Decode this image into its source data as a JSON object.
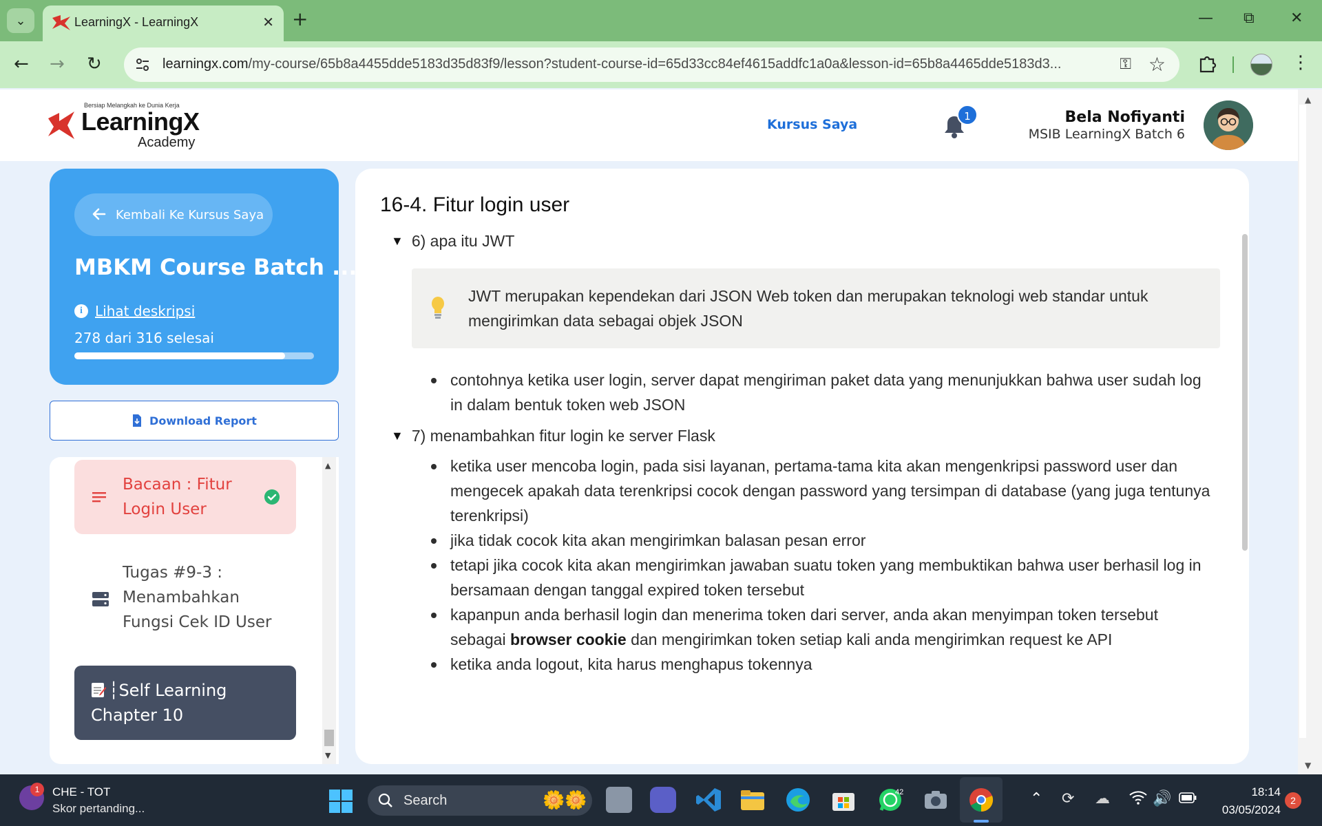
{
  "browser": {
    "tab_title": "LearningX - LearningX",
    "url_main": "learningx.com",
    "url_rest": "/my-course/65b8a4455dde5183d35d83f9/lesson?student-course-id=65d33cc84ef4615addfc1a0a&lesson-id=65b8a4465dde5183d3..."
  },
  "header": {
    "logo_tagline": "Bersiap Melangkah ke Dunia Kerja",
    "logo_word": "LearningX",
    "logo_sub": "Academy",
    "nav_kursus": "Kursus Saya",
    "notification_count": "1",
    "user_name": "Bela Nofiyanti",
    "user_batch": "MSIB LearningX Batch 6"
  },
  "sidebar": {
    "back_label": "Kembali Ke Kursus Saya",
    "course_title": "MBKM Course Batch ...",
    "description_link": "Lihat deskripsi",
    "progress_text": "278 dari 316 selesai",
    "progress_done": 278,
    "progress_total": 316,
    "download_label": "Download Report",
    "lessons": [
      {
        "label": "Bacaan : Fitur Login User",
        "active": true,
        "completed": true
      },
      {
        "label": "Tugas #9-3 : Menambahkan Fungsi Cek ID User",
        "active": false
      }
    ],
    "chapter_label": "┆Self Learning Chapter 10"
  },
  "content": {
    "title": "16-4.  Fitur login user",
    "section6": {
      "heading": "6)  apa itu JWT",
      "callout": "JWT merupakan kependekan dari JSON Web token dan merupakan teknologi web standar untuk mengirimkan data sebagai objek JSON",
      "bullets": [
        "contohnya ketika user login, server dapat mengiriman paket data yang menunjukkan bahwa user sudah log in dalam bentuk token web JSON"
      ]
    },
    "section7": {
      "heading": "7)  menambahkan fitur login ke server Flask",
      "bullets": [
        "ketika user mencoba login, pada sisi layanan, pertama-tama kita akan mengenkripsi password user dan mengecek apakah data terenkripsi cocok dengan password yang tersimpan di database (yang juga tentunya terenkripsi)",
        "jika tidak cocok kita akan mengirimkan balasan pesan error",
        "tetapi jika cocok kita akan mengirimkan jawaban suatu token yang membuktikan bahwa user berhasil log in bersamaan dengan tanggal expired token tersebut"
      ],
      "bullet4_before": "kapanpun anda berhasil login dan menerima token dari server, anda akan menyimpan token tersebut sebagai ",
      "bullet4_bold": "browser cookie",
      "bullet4_after": " dan mengirimkan token setiap kali anda mengirimkan request ke API",
      "bullet5": "ketika anda logout, kita harus menghapus tokennya"
    }
  },
  "taskbar": {
    "widget_badge": "1",
    "news_title": "CHE - TOT",
    "news_sub": "Skor pertanding...",
    "search_label": "Search",
    "whatsapp_badge": "42",
    "time": "18:14",
    "date": "03/05/2024",
    "notifications": "2"
  },
  "colors": {
    "brand_blue": "#3fa2f0",
    "link_blue": "#1e6fd9",
    "active_lesson_bg": "#fbdede",
    "active_lesson_text": "#e2413e",
    "chapter_bg": "#454f63",
    "browser_frame": "#7cbb7a"
  }
}
